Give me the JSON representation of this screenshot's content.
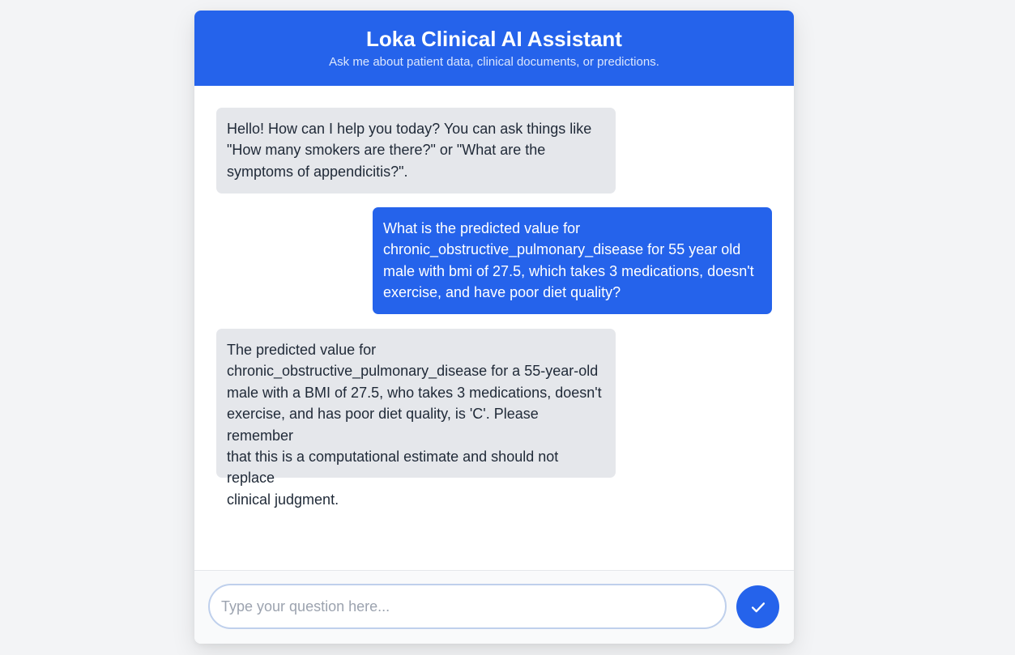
{
  "header": {
    "title": "Loka Clinical AI Assistant",
    "subtitle": "Ask me about patient data, clinical documents, or predictions."
  },
  "messages": [
    {
      "role": "assistant",
      "text": "Hello! How can I help you today? You can ask things like\n\"How many smokers are there?\" or \"What are the\nsymptoms of appendicitis?\"."
    },
    {
      "role": "user",
      "text": "What is the predicted value for\nchronic_obstructive_pulmonary_disease for 55 year old\nmale with bmi of 27.5, which takes 3 medications, doesn't\nexercise, and have poor diet quality?"
    },
    {
      "role": "assistant",
      "text": "The predicted value for\nchronic_obstructive_pulmonary_disease for a 55-year-old\nmale with a BMI of 27.5, who takes 3 medications, doesn't\nexercise, and has poor diet quality, is 'C'. Please remember\nthat this is a computational estimate and should not replace\nclinical judgment."
    }
  ],
  "input": {
    "value": "",
    "placeholder": "Type your question here..."
  },
  "send_button": {
    "icon": "checkmark-icon"
  },
  "colors": {
    "accent": "#2563eb",
    "assistant_bubble": "#e5e7eb",
    "background": "#f3f4f6"
  }
}
